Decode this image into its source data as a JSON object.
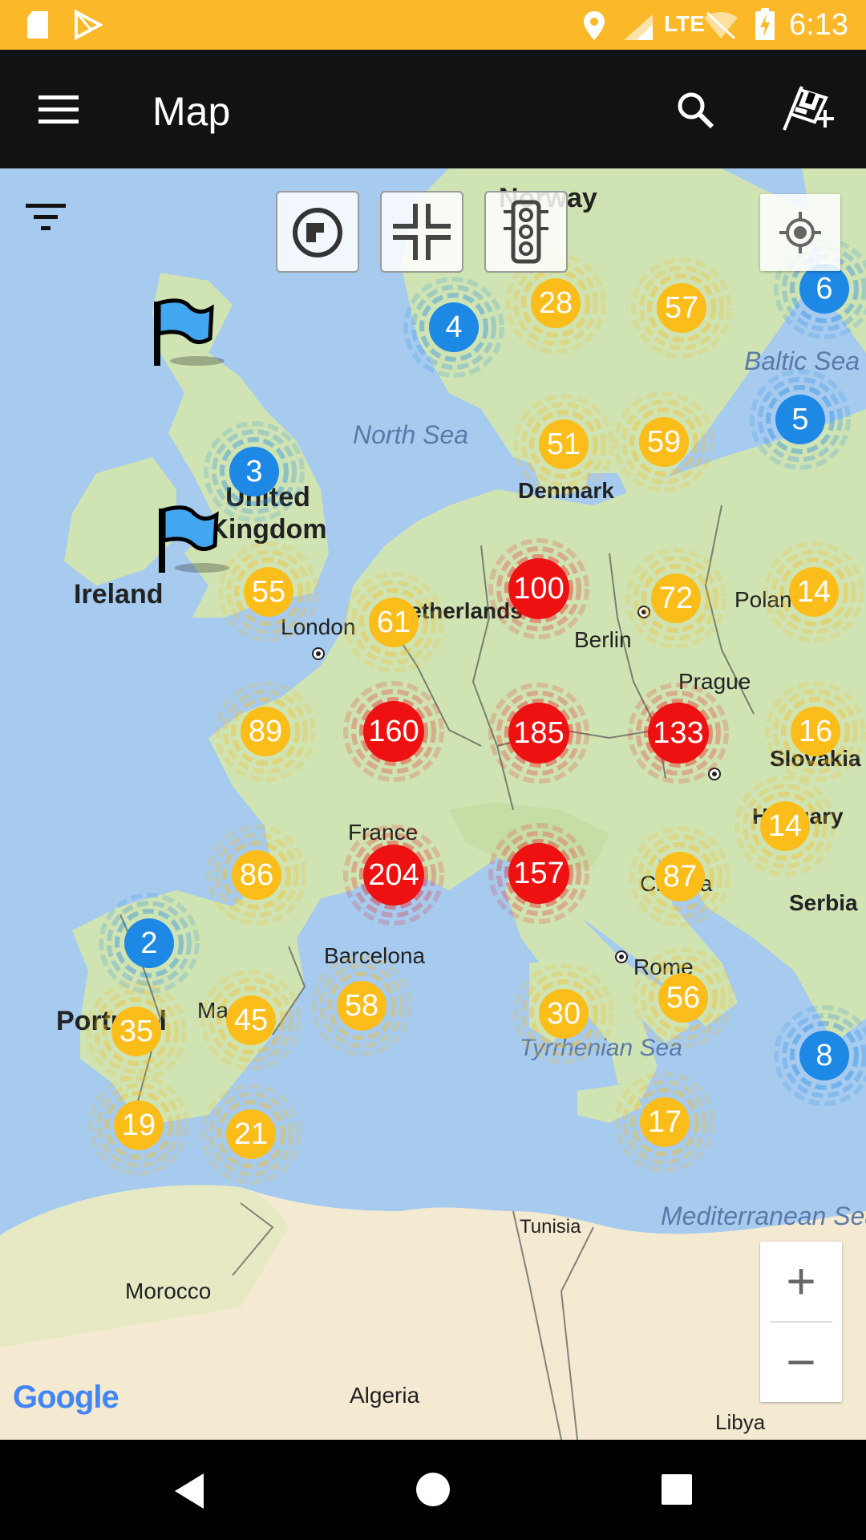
{
  "status_bar": {
    "time": "6:13",
    "network": "LTE",
    "accent": "#fbb829",
    "icons": [
      "sd-card-icon",
      "play-store-icon",
      "location-icon",
      "signal-icon",
      "wifi-off-icon",
      "battery-charging-icon"
    ]
  },
  "app_bar": {
    "title": "Map",
    "icons": [
      "menu-icon",
      "search-icon",
      "add-race-flag-icon"
    ]
  },
  "map_controls": {
    "icons": [
      "filter-icon",
      "circuit-icon",
      "pit-lane-icon",
      "traffic-light-icon",
      "my-location-icon"
    ],
    "zoom_in": "+",
    "zoom_out": "−"
  },
  "map": {
    "attribution": "Google",
    "colors": {
      "sea": "#a6cbef",
      "land": "#cfe3b3",
      "desert": "#f4ead2",
      "blue": "#1e88e5",
      "yellow": "#fbbd1a",
      "red": "#ee1111"
    },
    "labels": {
      "norway": "Norway",
      "baltic_sea": "Baltic Sea",
      "north_sea": "North Sea",
      "denmark": "Denmark",
      "united_kingdom": "United Kingdom",
      "ireland": "Ireland",
      "london": "London",
      "netherlands": "Netherlands",
      "berlin": "Berlin",
      "poland": "Poland",
      "prague": "Prague",
      "slovakia": "Slovakia",
      "france": "France",
      "hungary": "Hungary",
      "croatia": "Croatia",
      "serbia": "Serbia",
      "barcelona": "Barcelona",
      "madrid": "Madrid",
      "portugal": "Portugal",
      "rome": "Rome",
      "tyrrhenian_sea": "Tyrrhenian Sea",
      "tunisia": "Tunisia",
      "mediterranean_sea": "Mediterranean Sea",
      "morocco": "Morocco",
      "algeria": "Algeria",
      "libya": "Libya"
    },
    "clusters": [
      {
        "count": "28",
        "color": "yellow"
      },
      {
        "count": "57",
        "color": "yellow"
      },
      {
        "count": "4",
        "color": "blue"
      },
      {
        "count": "6",
        "color": "blue"
      },
      {
        "count": "5",
        "color": "blue"
      },
      {
        "count": "3",
        "color": "blue"
      },
      {
        "count": "51",
        "color": "yellow"
      },
      {
        "count": "59",
        "color": "yellow"
      },
      {
        "count": "100",
        "color": "red"
      },
      {
        "count": "72",
        "color": "yellow"
      },
      {
        "count": "14",
        "color": "yellow"
      },
      {
        "count": "55",
        "color": "yellow"
      },
      {
        "count": "61",
        "color": "yellow"
      },
      {
        "count": "89",
        "color": "yellow"
      },
      {
        "count": "160",
        "color": "red"
      },
      {
        "count": "185",
        "color": "red"
      },
      {
        "count": "133",
        "color": "red"
      },
      {
        "count": "16",
        "color": "yellow"
      },
      {
        "count": "14",
        "color": "yellow"
      },
      {
        "count": "86",
        "color": "yellow"
      },
      {
        "count": "204",
        "color": "red"
      },
      {
        "count": "157",
        "color": "red"
      },
      {
        "count": "87",
        "color": "yellow"
      },
      {
        "count": "2",
        "color": "blue"
      },
      {
        "count": "58",
        "color": "yellow"
      },
      {
        "count": "30",
        "color": "yellow"
      },
      {
        "count": "56",
        "color": "yellow"
      },
      {
        "count": "35",
        "color": "yellow"
      },
      {
        "count": "45",
        "color": "yellow"
      },
      {
        "count": "8",
        "color": "blue"
      },
      {
        "count": "19",
        "color": "yellow"
      },
      {
        "count": "21",
        "color": "yellow"
      },
      {
        "count": "17",
        "color": "yellow"
      }
    ]
  },
  "nav_bar": {
    "icons": [
      "back-icon",
      "home-icon",
      "recents-icon"
    ]
  }
}
